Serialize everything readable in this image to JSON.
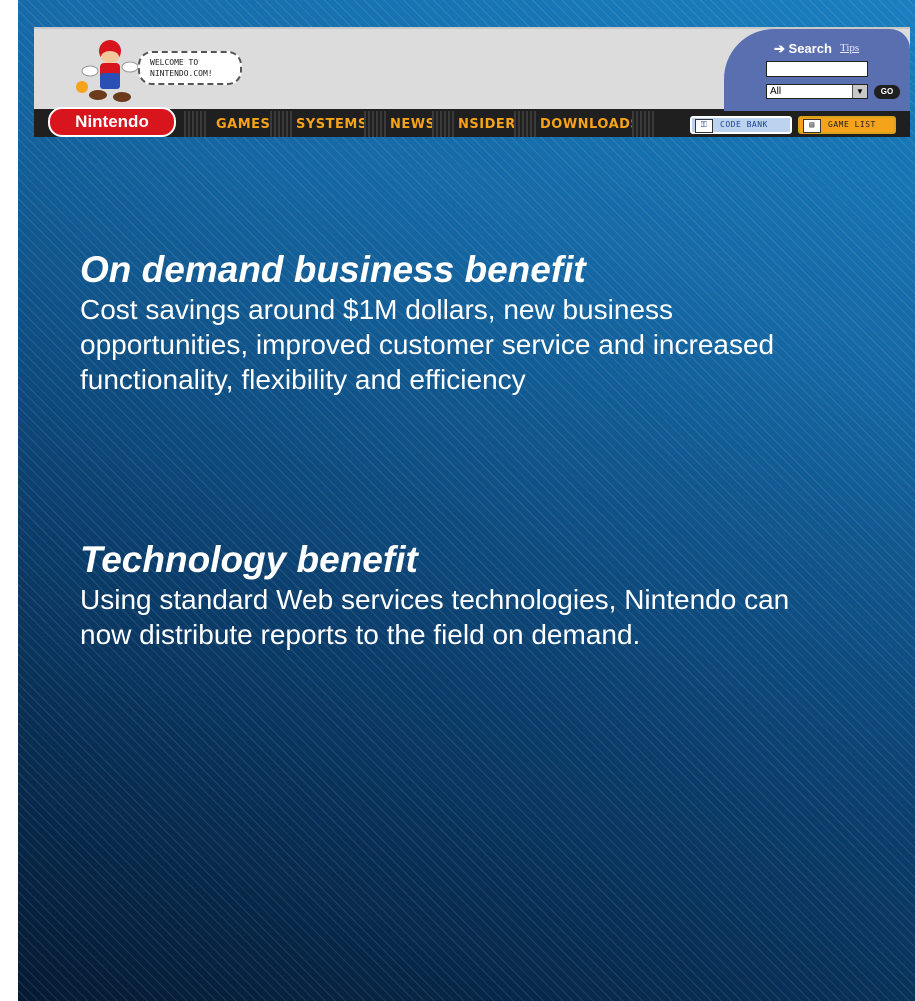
{
  "banner": {
    "welcome_text": "WELCOME TO NINTENDO.COM!",
    "logo_text": "Nintendo",
    "nav": [
      "GAMES",
      "SYSTEMS",
      "NEWS",
      "NSIDER",
      "DOWNLOADS"
    ],
    "search": {
      "title": "Search",
      "tips": "Tips",
      "input_value": "",
      "select_value": "All",
      "go_label": "GO"
    },
    "buttons": {
      "code_bank": "CODE BANK",
      "game_list": "GAME LIST"
    }
  },
  "sections": [
    {
      "heading": "On demand business benefit",
      "body": "Cost savings around $1M dollars, new business opportunities, improved customer service and increased functionality, flexibility and efficiency"
    },
    {
      "heading": "Technology benefit",
      "body": "Using standard Web services technologies, Nintendo can now distribute reports to the field on demand."
    }
  ],
  "colors": {
    "nav_text": "#f5a31a",
    "logo_red": "#d8141d",
    "slide_top": "#1a7fc0",
    "slide_bottom": "#051a33",
    "search_panel": "#5a6fb0"
  }
}
